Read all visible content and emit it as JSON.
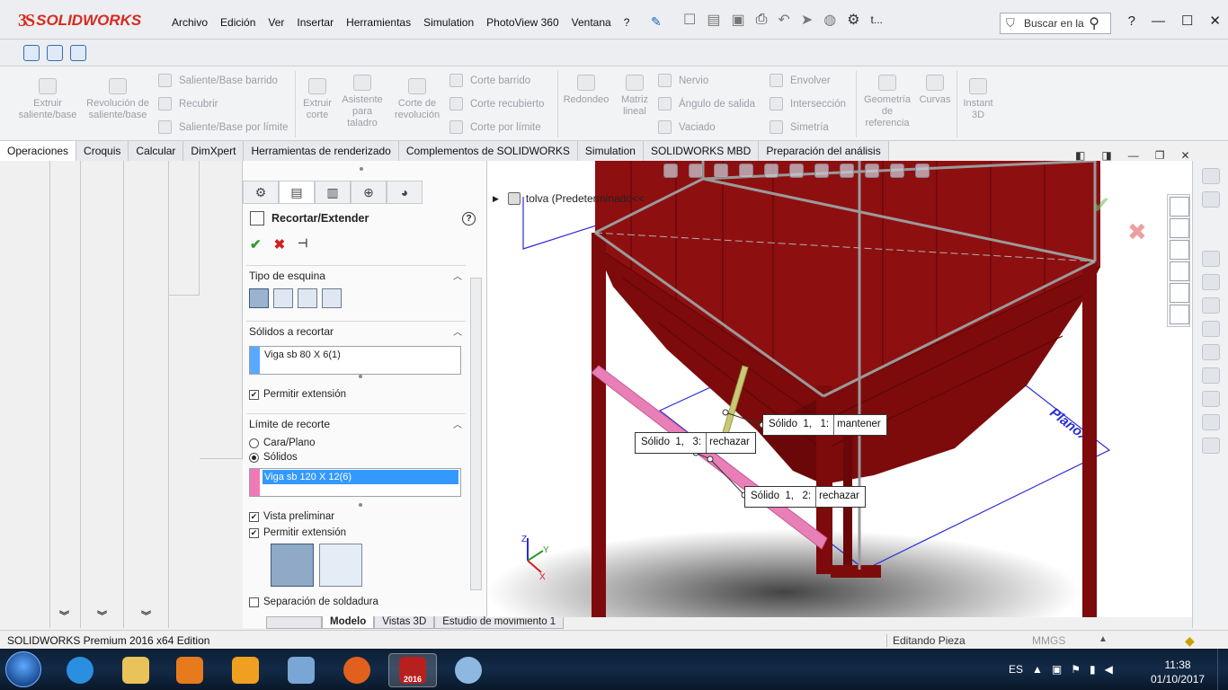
{
  "app": {
    "brand_ds": "3S",
    "brand_name": "SOLIDWORKS",
    "menus": [
      "Archivo",
      "Edición",
      "Ver",
      "Insertar",
      "Herramientas",
      "Simulation",
      "PhotoView 360",
      "Ventana",
      "?"
    ],
    "search_placeholder": "Buscar en la",
    "title_short": "t..."
  },
  "commands": {
    "extruir_saliente": "Extruir saliente/base",
    "revolucion_saliente": "Revolución de saliente/base",
    "saliente_barrido": "Saliente/Base barrido",
    "recubrir": "Recubrir",
    "saliente_limite": "Saliente/Base por límite",
    "extruir_corte": "Extruir corte",
    "asistente_taladro": "Asistente para taladro",
    "corte_revolucion": "Corte de revolución",
    "corte_barrido": "Corte barrido",
    "corte_recubierto": "Corte recubierto",
    "corte_limite": "Corte por límite",
    "redondeo": "Redondeo",
    "matriz_lineal": "Matriz lineal",
    "nervio": "Nervio",
    "angulo_salida": "Ángulo de salida",
    "vaciado": "Vaciado",
    "envolver": "Envolver",
    "interseccion": "Intersección",
    "simetria": "Simetría",
    "geometria_referencia": "Geometría de referencia",
    "curvas": "Curvas",
    "instant3d": "Instant 3D"
  },
  "tabs": [
    "Operaciones",
    "Croquis",
    "Calcular",
    "DimXpert",
    "Herramientas de renderizado",
    "Complementos de SOLIDWORKS",
    "Simulation",
    "SOLIDWORKS MBD",
    "Preparación del análisis"
  ],
  "property_manager": {
    "title": "Recortar/Extender",
    "help": "?",
    "group_corner": "Tipo de esquina",
    "group_bodies_trim": "Sólidos a recortar",
    "bodies_trim_item": "Viga sb 80 X 6(1)",
    "allow_extension_1": "Permitir extensión",
    "group_limit": "Límite de recorte",
    "radio_face": "Cara/Plano",
    "radio_bodies": "Sólidos",
    "limit_item": "Viga sb 120 X 12(6)",
    "preview": "Vista preliminar",
    "allow_extension_2": "Permitir extensión",
    "weld_gap": "Separación de soldadura"
  },
  "bottom_tabs": [
    "Modelo",
    "Vistas 3D",
    "Estudio de movimiento 1"
  ],
  "viewport": {
    "tree_label": "tolva  (Predeterminado<<",
    "plane_label": "PlanoX",
    "callouts": [
      {
        "left": "Sólido  1,   1:",
        "right": "mantener"
      },
      {
        "left": "Sólido  1,   3:",
        "right": "rechazar"
      },
      {
        "left": "Sólido  1,   2:",
        "right": "rechazar"
      }
    ],
    "axes": {
      "x": "X",
      "y": "Y",
      "z": "Z"
    }
  },
  "status": {
    "edition": "SOLIDWORKS Premium 2016 x64 Edition",
    "mode": "Editando Pieza",
    "units": "MMGS",
    "units_caret": "▲"
  },
  "taskbar": {
    "lang": "ES",
    "time": "11:38",
    "date": "01/10/2017",
    "sw_badge": "2016"
  },
  "colors": {
    "model_red": "#8e0f10",
    "beam_pink": "#e87fb6",
    "accent_blue": "#3399ff",
    "flag_blue": "#5aa8ff",
    "flag_pink": "#f07ab5"
  }
}
